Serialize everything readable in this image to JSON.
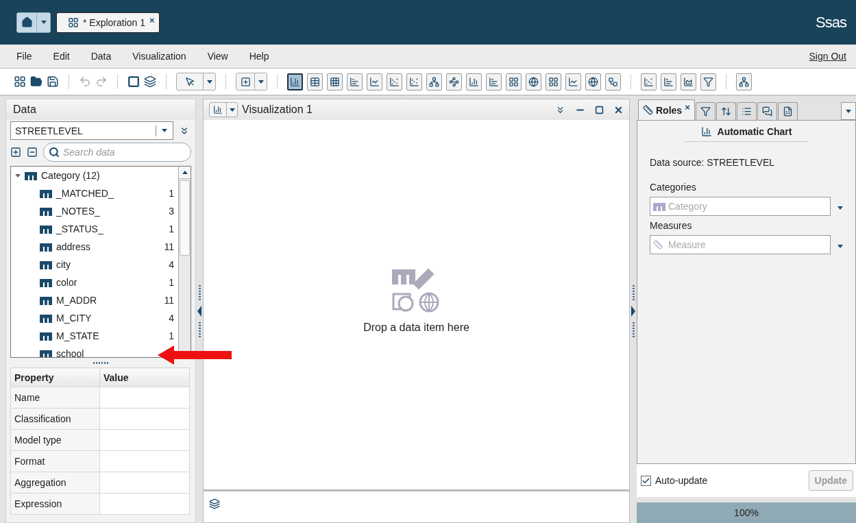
{
  "header": {
    "tab": {
      "label": "* Exploration 1",
      "close": "×"
    },
    "logo": "Ssas"
  },
  "menu": {
    "items": [
      "File",
      "Edit",
      "Data",
      "Visualization",
      "View",
      "Help"
    ],
    "sign_out": "Sign Out"
  },
  "toolbar": {
    "chart_buttons": [
      {
        "selected": true
      },
      {
        "selected": false
      },
      {
        "selected": false
      },
      {
        "selected": false
      },
      {
        "selected": false
      },
      {
        "selected": false
      },
      {
        "selected": false
      },
      {
        "selected": false
      },
      {
        "selected": false
      },
      {
        "selected": false
      },
      {
        "selected": false
      },
      {
        "selected": false
      },
      {
        "selected": false
      },
      {
        "selected": false
      },
      {
        "selected": false
      },
      {
        "selected": false
      },
      {
        "selected": false
      },
      {
        "selected": false
      },
      {
        "selected": false
      },
      {
        "selected": false
      },
      {
        "selected": false
      },
      {
        "selected": false
      }
    ]
  },
  "data_panel": {
    "title": "Data",
    "source": "STREETLEVEL",
    "search": {
      "placeholder": "Search data"
    },
    "tree": [
      {
        "label": "Category (12)",
        "expanded": true,
        "children": [
          {
            "label": "_MATCHED_",
            "count": "1"
          },
          {
            "label": "_NOTES_",
            "count": "3"
          },
          {
            "label": "_STATUS_",
            "count": "1"
          },
          {
            "label": "address",
            "count": "11"
          },
          {
            "label": "city",
            "count": "4"
          },
          {
            "label": "color",
            "count": "1"
          },
          {
            "label": "M_ADDR",
            "count": "11"
          },
          {
            "label": "M_CITY",
            "count": "4"
          },
          {
            "label": "M_STATE",
            "count": "1"
          },
          {
            "label": "school"
          }
        ]
      }
    ],
    "properties": {
      "columns": [
        "Property",
        "Value"
      ],
      "rows": [
        "Name",
        "Classification",
        "Model type",
        "Format",
        "Aggregation",
        "Expression"
      ]
    }
  },
  "visualization": {
    "title": "Visualization 1",
    "drop_hint": "Drop a data item here"
  },
  "roles_panel": {
    "tabs": [
      {
        "label": "Roles",
        "close": "×",
        "selected": true
      },
      {
        "selected": false
      },
      {
        "selected": false
      },
      {
        "selected": false
      },
      {
        "selected": false
      },
      {
        "selected": false
      }
    ],
    "chart_type": "Automatic Chart",
    "data_source": "Data source:  STREETLEVEL",
    "categories": {
      "label": "Categories",
      "placeholder": "Category"
    },
    "measures": {
      "label": "Measures",
      "placeholder": "Measure"
    },
    "auto_update": {
      "label": "Auto-update",
      "checked": true
    },
    "update_button": {
      "label": "Update",
      "disabled": true
    },
    "progress": {
      "level": 1,
      "reading": "100%"
    }
  }
}
